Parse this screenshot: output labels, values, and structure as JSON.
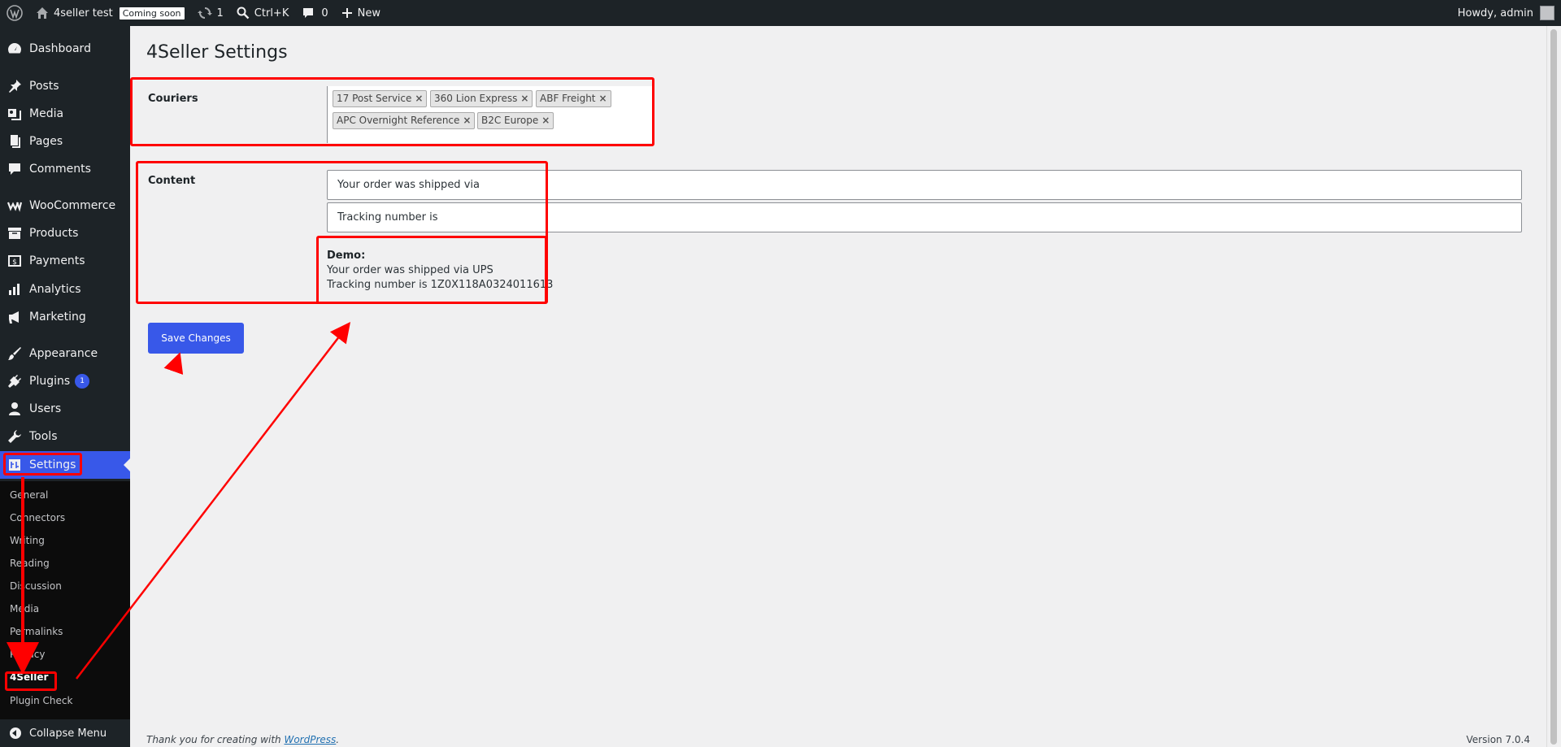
{
  "adminbar": {
    "site_name": "4seller test",
    "coming_soon": "Coming soon",
    "updates_count": "1",
    "search_shortcut": "Ctrl+K",
    "comments_count": "0",
    "new_label": "New",
    "howdy": "Howdy, admin"
  },
  "sidebar": {
    "items": [
      {
        "label": "Dashboard",
        "icon": "dashboard-icon"
      },
      {
        "label": "Posts",
        "icon": "pin-icon"
      },
      {
        "label": "Media",
        "icon": "media-icon"
      },
      {
        "label": "Pages",
        "icon": "pages-icon"
      },
      {
        "label": "Comments",
        "icon": "comment-icon"
      },
      {
        "label": "WooCommerce",
        "icon": "woocommerce-icon"
      },
      {
        "label": "Products",
        "icon": "archive-icon"
      },
      {
        "label": "Payments",
        "icon": "dollar-icon"
      },
      {
        "label": "Analytics",
        "icon": "bar-chart-icon"
      },
      {
        "label": "Marketing",
        "icon": "megaphone-icon"
      },
      {
        "label": "Appearance",
        "icon": "brush-icon"
      },
      {
        "label": "Plugins",
        "icon": "plugin-icon",
        "badge": "1"
      },
      {
        "label": "Users",
        "icon": "user-icon"
      },
      {
        "label": "Tools",
        "icon": "wrench-icon"
      },
      {
        "label": "Settings",
        "icon": "settings-icon",
        "current": true
      }
    ],
    "submenu": [
      "General",
      "Connectors",
      "Writing",
      "Reading",
      "Discussion",
      "Media",
      "Permalinks",
      "Privacy",
      "4Seller",
      "Plugin Check"
    ],
    "collapse_label": "Collapse Menu"
  },
  "page": {
    "title": "4Seller Settings",
    "couriers_label": "Couriers",
    "couriers": [
      "17 Post Service",
      "360 Lion Express",
      "ABF Freight",
      "APC Overnight Reference",
      "B2C Europe"
    ],
    "content_label": "Content",
    "shipped_via_value": "Your order was shipped via",
    "tracking_value": "Tracking number is",
    "demo_title": "Demo:",
    "demo_line1": "Your order was shipped via UPS",
    "demo_line2": "Tracking number is 1Z0X118A0324011613",
    "save_label": "Save Changes"
  },
  "footer": {
    "thanks_prefix": "Thank you for creating with ",
    "thanks_link": "WordPress",
    "thanks_suffix": ".",
    "version": "Version 7.0.4"
  },
  "colors": {
    "accent": "#3858e9",
    "annotation": "#ff0000",
    "sidebar_bg": "#1d2327"
  }
}
